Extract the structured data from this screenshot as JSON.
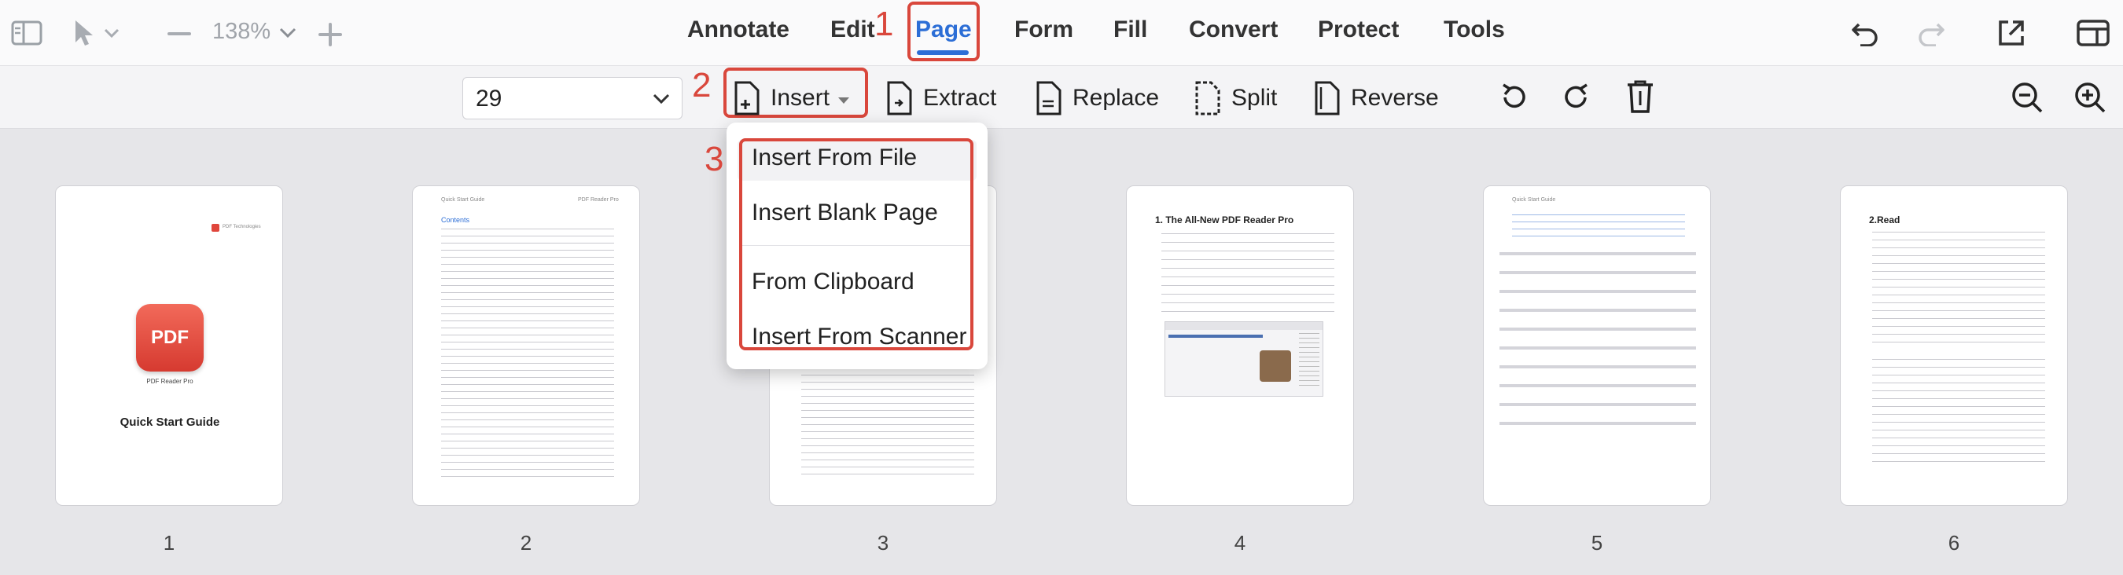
{
  "toolbar_top": {
    "zoom": "138%",
    "tabs": [
      "Annotate",
      "Edit",
      "Page",
      "Form",
      "Fill",
      "Convert",
      "Protect",
      "Tools"
    ],
    "active_tab": "Page",
    "icons": [
      "sidebar-toggle-icon",
      "pointer-tool-icon",
      "zoom-out-icon",
      "zoom-in-icon",
      "undo-icon",
      "redo-icon",
      "share-icon",
      "layout-icon"
    ]
  },
  "toolbar_page": {
    "page_select_value": "29",
    "insert_label": "Insert",
    "extract_label": "Extract",
    "replace_label": "Replace",
    "split_label": "Split",
    "reverse_label": "Reverse",
    "icons": [
      "rotate-left-icon",
      "rotate-right-icon",
      "delete-icon",
      "zoom-out-icon",
      "zoom-in-icon"
    ]
  },
  "insert_menu": {
    "items": [
      "Insert From File",
      "Insert Blank Page",
      "From Clipboard",
      "Insert From Scanner"
    ]
  },
  "annotations": {
    "step1": "1",
    "step2": "2",
    "step3": "3",
    "color": "#d9473c"
  },
  "pages": {
    "numbers": [
      "1",
      "2",
      "3",
      "4",
      "5",
      "6"
    ],
    "cover_title": "Quick Start Guide",
    "cover_app_name": "PDF Reader Pro",
    "cover_logo_text": "PDF",
    "cover_company": "PDF Technologies",
    "p2_header_left": "Quick Start Guide",
    "p2_header_right": "PDF Reader Pro",
    "p2_contents": "Contents",
    "p4_heading": "1.  The All-New PDF Reader Pro",
    "p5_header_left": "Quick Start Guide",
    "p6_heading": "2.Read"
  },
  "colors": {
    "accent": "#2c6ed6",
    "annotation_red": "#d9473c",
    "logo_red": "#e0463c"
  }
}
